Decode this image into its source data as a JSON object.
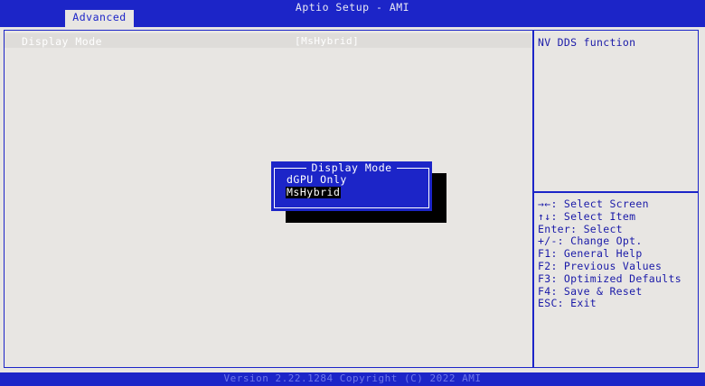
{
  "header": {
    "title": "Aptio Setup - AMI",
    "tabs": [
      {
        "label": "Advanced",
        "active": true
      }
    ]
  },
  "settings": [
    {
      "label": "Display Mode",
      "value": "[MsHybrid]"
    }
  ],
  "help": {
    "description": "NV DDS function",
    "hints": [
      "→←: Select Screen",
      "↑↓: Select Item",
      "Enter: Select",
      "+/-: Change Opt.",
      "F1: General Help",
      "F2: Previous Values",
      "F3: Optimized Defaults",
      "F4: Save & Reset",
      "ESC: Exit"
    ]
  },
  "popup": {
    "title": "Display Mode",
    "options": [
      {
        "label": "dGPU Only",
        "selected": false
      },
      {
        "label": "MsHybrid",
        "selected": true
      }
    ]
  },
  "footer": {
    "text": "Version 2.22.1284 Copyright (C) 2022 AMI"
  },
  "colors": {
    "bios_blue": "#1c25c8",
    "panel_bg": "#e8e6e3",
    "text_blue": "#1a1aa8"
  }
}
